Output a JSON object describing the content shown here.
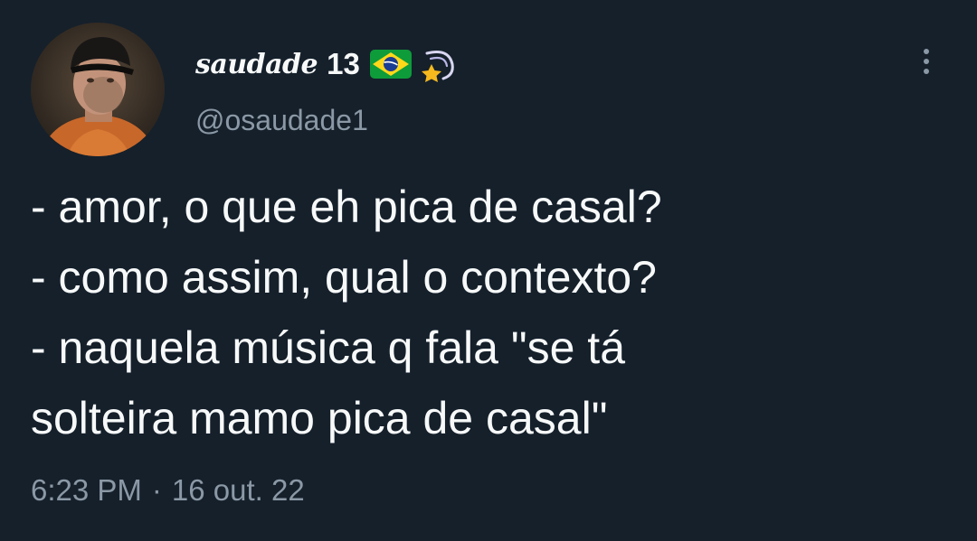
{
  "author": {
    "display_name": "saudade",
    "display_number": "13",
    "handle": "@osaudade1",
    "name_emojis": [
      "brazil-flag",
      "shooting-star"
    ]
  },
  "tweet": {
    "lines": [
      "- amor, o que eh pica de casal?",
      "- como assim, qual o contexto?",
      "- naquela música q fala \"se tá",
      "solteira mamo pica de casal\""
    ]
  },
  "meta": {
    "time": "6:23 PM",
    "separator": "·",
    "date": "16 out. 22"
  },
  "icons": {
    "more": "more-vertical-icon"
  },
  "colors": {
    "background": "#15202b",
    "text_primary": "#f7f9f9",
    "text_secondary": "#8b98a5"
  }
}
